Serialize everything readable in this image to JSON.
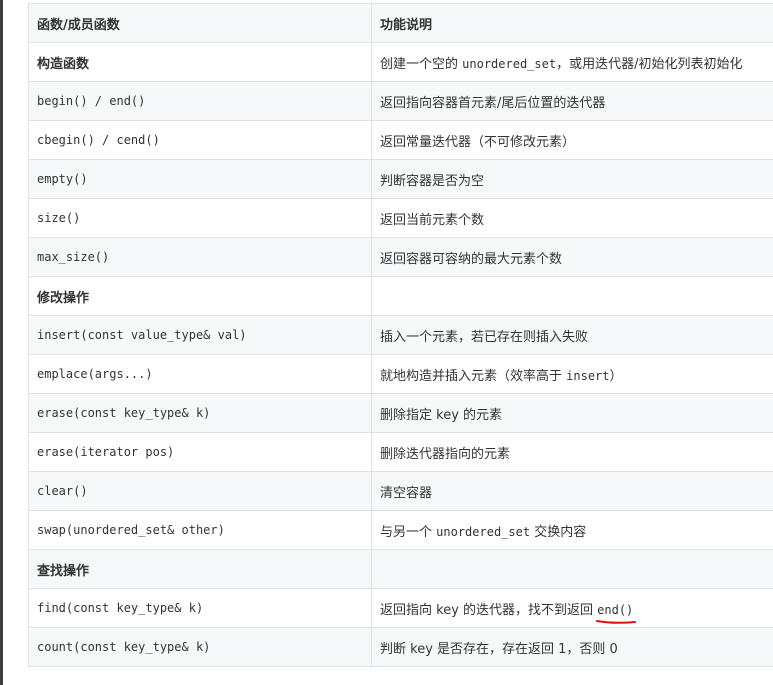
{
  "table": {
    "headers": [
      "函数/成员函数",
      "功能说明"
    ],
    "rows": [
      {
        "kind": "section",
        "fn": "构造函数",
        "desc_parts": [
          {
            "t": "text",
            "v": "创建一个空的 "
          },
          {
            "t": "code",
            "v": "unordered_set"
          },
          {
            "t": "text",
            "v": "，或用迭代器/初始化列表初始化"
          }
        ]
      },
      {
        "kind": "row",
        "fn": "begin() / end()",
        "desc_parts": [
          {
            "t": "text",
            "v": "返回指向容器首元素/尾后位置的迭代器"
          }
        ]
      },
      {
        "kind": "row",
        "fn": "cbegin() / cend()",
        "desc_parts": [
          {
            "t": "text",
            "v": "返回常量迭代器（不可修改元素）"
          }
        ]
      },
      {
        "kind": "row",
        "fn": "empty()",
        "desc_parts": [
          {
            "t": "text",
            "v": "判断容器是否为空"
          }
        ]
      },
      {
        "kind": "row",
        "fn": "size()",
        "desc_parts": [
          {
            "t": "text",
            "v": "返回当前元素个数"
          }
        ]
      },
      {
        "kind": "row",
        "fn": "max_size()",
        "desc_parts": [
          {
            "t": "text",
            "v": "返回容器可容纳的最大元素个数"
          }
        ]
      },
      {
        "kind": "section",
        "fn": "修改操作",
        "desc_parts": []
      },
      {
        "kind": "row",
        "fn": "insert(const value_type& val)",
        "desc_parts": [
          {
            "t": "text",
            "v": "插入一个元素，若已存在则插入失败"
          }
        ]
      },
      {
        "kind": "row",
        "fn": "emplace(args...)",
        "desc_parts": [
          {
            "t": "text",
            "v": "就地构造并插入元素（效率高于 "
          },
          {
            "t": "code",
            "v": "insert"
          },
          {
            "t": "text",
            "v": "）"
          }
        ]
      },
      {
        "kind": "row",
        "fn": "erase(const key_type& k)",
        "desc_parts": [
          {
            "t": "text",
            "v": "删除指定 key 的元素"
          }
        ]
      },
      {
        "kind": "row",
        "fn": "erase(iterator pos)",
        "desc_parts": [
          {
            "t": "text",
            "v": "删除迭代器指向的元素"
          }
        ]
      },
      {
        "kind": "row",
        "fn": "clear()",
        "desc_parts": [
          {
            "t": "text",
            "v": "清空容器"
          }
        ]
      },
      {
        "kind": "row",
        "fn": "swap(unordered_set& other)",
        "desc_parts": [
          {
            "t": "text",
            "v": "与另一个 "
          },
          {
            "t": "code",
            "v": "unordered_set"
          },
          {
            "t": "text",
            "v": " 交换内容"
          }
        ]
      },
      {
        "kind": "section",
        "fn": "查找操作",
        "desc_parts": []
      },
      {
        "kind": "row",
        "fn": "find(const key_type& k)",
        "desc_parts": [
          {
            "t": "text",
            "v": "返回指向 key 的迭代器，找不到返回 "
          },
          {
            "t": "code-marked",
            "v": "end()"
          }
        ]
      },
      {
        "kind": "row",
        "fn": "count(const key_type& k)",
        "desc_parts": [
          {
            "t": "text",
            "v": "判断 key 是否存在，存在返回 1，否则 0"
          }
        ]
      }
    ]
  },
  "colors": {
    "border": "#dfe2e5",
    "stripe": "#f6f8fa",
    "text": "#333333",
    "annotation": "#e01010"
  }
}
